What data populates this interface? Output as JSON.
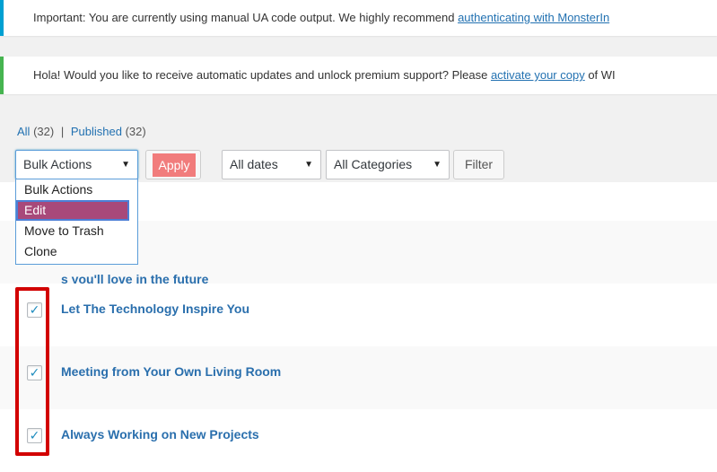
{
  "notices": [
    {
      "text_before": "Important: You are currently using manual UA code output. We highly recommend ",
      "link_text": "authenticating with MonsterIn",
      "border_color": "#00a0d2"
    },
    {
      "text_before": "Hola! Would you like to receive automatic updates and unlock premium support? Please ",
      "link_text": "activate your copy",
      "text_after": " of WI",
      "border_color": "#46b450"
    }
  ],
  "filters": {
    "all_label": "All",
    "all_count": "(32)",
    "separator": "|",
    "published_label": "Published",
    "published_count": "(32)"
  },
  "toolbar": {
    "bulk_actions_value": "Bulk Actions",
    "apply_label": "Apply",
    "dates_value": "All dates",
    "categories_value": "All Categories",
    "filter_label": "Filter"
  },
  "bulk_dropdown": {
    "options": [
      "Bulk Actions",
      "Edit",
      "Move to Trash",
      "Clone"
    ],
    "selected_index": 1
  },
  "posts": [
    {
      "title_visible": "s you'll love in the future",
      "checked": false
    },
    {
      "title": "Let The Technology Inspire You",
      "checked": true
    },
    {
      "title": "Meeting from Your Own Living Room",
      "checked": true
    },
    {
      "title": "Always Working on New Projects",
      "checked": true
    }
  ],
  "icons": {
    "select_arrow": "▼",
    "checkmark": "✓"
  },
  "colors": {
    "link": "#2271b1",
    "highlight_apply": "#f17c7c",
    "dropdown_selected": "#a8497a",
    "annotation_red": "#d20000"
  }
}
